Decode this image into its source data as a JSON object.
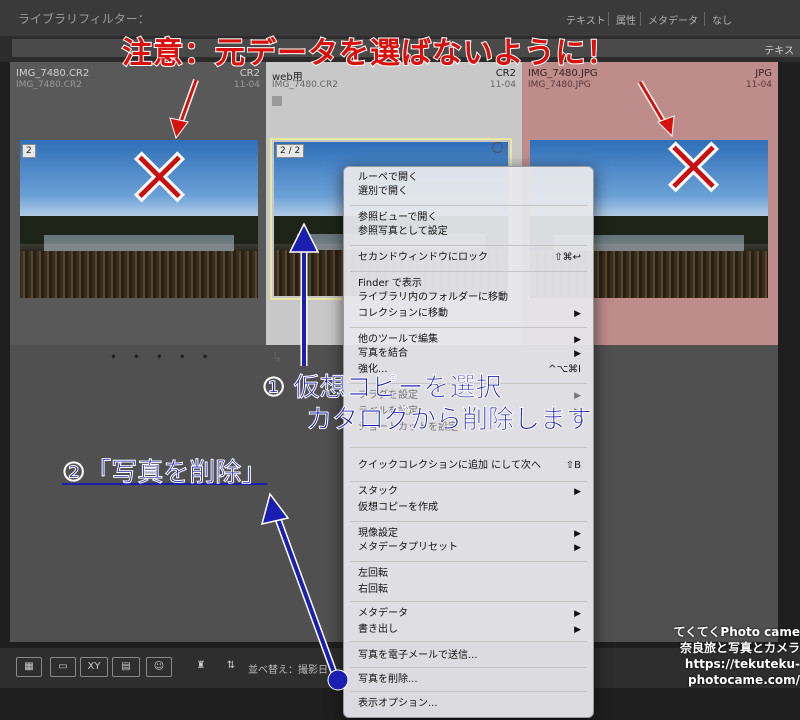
{
  "filter_bar": {
    "title": "ライブラリフィルター：",
    "tabs": [
      "テキスト",
      "属性",
      "メタデータ",
      "なし"
    ],
    "row2_label": "テキス"
  },
  "cells": [
    {
      "name": "IMG_7480.CR2",
      "sub": "IMG_7480.CR2",
      "ext": "CR2",
      "date": "11-04",
      "badge": "2",
      "bg": "#595959",
      "text": "#cfcfcf"
    },
    {
      "name": "web用",
      "sub": "IMG_7480.CR2",
      "ext": "CR2",
      "date": "11-04",
      "badge": "2 / 2",
      "bg": "#c8c8c8",
      "text": "#222222"
    },
    {
      "name": "IMG_7480.JPG",
      "sub": "IMG_7480.JPG",
      "ext": "JPG",
      "date": "11-04",
      "bg": "#bf8c8c",
      "text": "#3a2222"
    }
  ],
  "dots": "• • • • •",
  "toolbar": {
    "xy": "XY",
    "sort": "並べ替え：撮影日"
  },
  "menu": {
    "g1": [
      "ルーペで開く",
      "選別で開く"
    ],
    "g2": [
      "参照ビューで開く",
      "参照写真として設定"
    ],
    "g3": {
      "label": "セカンドウィンドウにロック",
      "shortcut": "⇧⌘↩"
    },
    "g4": [
      "Finder で表示",
      "ライブラリ内のフォルダーに移動",
      "コレクションに移動"
    ],
    "g5": [
      "他のツールで編集",
      "写真を結合",
      "強化..."
    ],
    "g5_shortcut": "^⌥⌘I",
    "g6_hidden": [
      "フラグを設定",
      "ラベルを設定",
      "ショートカットを設定"
    ],
    "g7": {
      "label": "クイックコレクションに追加 にして次へ",
      "shortcut": "⇧B"
    },
    "g8": [
      "スタック",
      "仮想コピーを作成"
    ],
    "g9": [
      "現像設定",
      "メタデータプリセット"
    ],
    "g10": [
      "左回転",
      "右回転"
    ],
    "g11": [
      "メタデータ",
      "書き出し"
    ],
    "g12": [
      "写真を電子メールで送信..."
    ],
    "g13": [
      "写真を削除..."
    ],
    "g14": [
      "表示オプション..."
    ],
    "arrow": "▶"
  },
  "annotations": {
    "warning": "注意：元データを選ばないように！",
    "step1_line1": "① 仮想コピーを選択",
    "step1_line2": "カタログから削除します",
    "step2": "②「写真を削除」",
    "cross": "✕"
  },
  "credit": [
    "てくてくPhoto came",
    "奈良旅と写真とカメラ",
    "https://tekuteku-photocame.com/"
  ],
  "colors": {
    "accent_red": "#d8110c",
    "accent_blue": "#1a1fb0",
    "selection_yellow": "#e8e8a0"
  }
}
